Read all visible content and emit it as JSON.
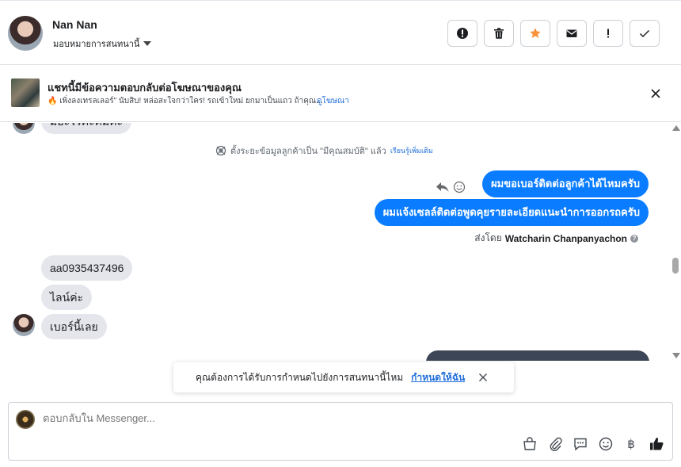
{
  "header": {
    "name": "Nan Nan",
    "assign_label": "มอบหมายการสนทนานี้",
    "actions": [
      "spam-icon",
      "trash-icon",
      "star-icon",
      "mail-icon",
      "important-icon",
      "check-icon"
    ]
  },
  "ad_banner": {
    "title": "แชทนี้มีข้อความตอบกลับต่อโฆษณาของคุณ",
    "subtitle": "🔥 เพิ่งลงเทรลเลอร์\" นับสิบ! หล่อสะใจกว่าใคร! รถเข้าใหม่ ยกมาเป็นแถว ถ้าคุณ...",
    "link": "ดูโฆษณา"
  },
  "chat": {
    "partial_top": "มีอะไรค่ะคัมคะ",
    "system_notice": "ตั้งระยะข้อมูลลูกค้าเป็น \"มีคุณสมบัติ\" แล้ว",
    "system_link": "เรียนรู้เพิ่มเติม",
    "outgoing": [
      "ผมขอเบอร์ติดต่อลูกค้าได้ไหมครับ",
      "ผมแจ้งเซลล์ติดต่อพูดคุยรายละเอียดแนะนำการออกรถครับ"
    ],
    "sent_by_prefix": "ส่งโดย",
    "sent_by_name": "Watcharin Chanpanyachon",
    "incoming": [
      "aa0935437496",
      "ไลน์ค่ะ",
      "เบอร์นี้เลย"
    ]
  },
  "toast": {
    "text": "คุณต้องการได้รับการกำหนดไปยังการสนทนานี้ไหม",
    "link": "กำหนดให้ฉัน"
  },
  "composer": {
    "placeholder": "ตอบกลับใน Messenger...",
    "tools": [
      "shop-icon",
      "attach-icon",
      "saved-reply-icon",
      "emoji-icon",
      "baht-icon",
      "like-icon"
    ]
  },
  "colors": {
    "outgoing_bubble": "#0a7cff",
    "incoming_bubble": "#e4e6eb",
    "link": "#216fdb",
    "star": "#f7923b"
  }
}
